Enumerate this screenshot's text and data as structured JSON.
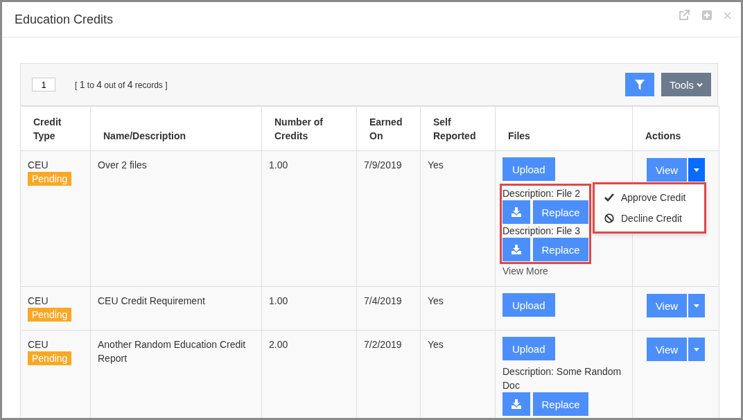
{
  "window": {
    "title": "Education Credits"
  },
  "toolbar": {
    "page": "1",
    "range_open": "[",
    "range_close": "]",
    "range_start": "1",
    "range_to": "to",
    "range_end": "4",
    "range_out_of": "out of",
    "range_total": "4",
    "range_records": "records",
    "tools_label": "Tools"
  },
  "table": {
    "columns": [
      "Credit Type",
      "Name/Description",
      "Number of Credits",
      "Earned On",
      "Self Reported",
      "Files",
      "Actions"
    ],
    "rows": [
      {
        "credit_type": "CEU",
        "status": "Pending",
        "name": "Over 2 files",
        "credits": "1.00",
        "earned_on": "7/9/2019",
        "self_reported": "Yes",
        "upload_label": "Upload",
        "files": [
          {
            "description": "Description: File 2",
            "replace_label": "Replace"
          },
          {
            "description": "Description: File 3",
            "replace_label": "Replace"
          }
        ],
        "files_highlighted": true,
        "view_more": "View More",
        "view_label": "View",
        "menu_open": true,
        "menu_items": [
          {
            "kind": "approve",
            "label": "Approve Credit"
          },
          {
            "kind": "decline",
            "label": "Decline Credit"
          }
        ]
      },
      {
        "credit_type": "CEU",
        "status": "Pending",
        "name": "CEU Credit Requirement",
        "credits": "1.00",
        "earned_on": "7/4/2019",
        "self_reported": "Yes",
        "upload_label": "Upload",
        "files": [],
        "files_highlighted": false,
        "view_label": "View",
        "menu_open": false
      },
      {
        "credit_type": "CEU",
        "status": "Pending",
        "name": "Another Random Education Credit Report",
        "credits": "2.00",
        "earned_on": "7/2/2019",
        "self_reported": "Yes",
        "upload_label": "Upload",
        "files": [
          {
            "description": "Description: Some Random Doc",
            "replace_label": "Replace"
          }
        ],
        "files_highlighted": false,
        "view_label": "View",
        "menu_open": false
      }
    ]
  }
}
